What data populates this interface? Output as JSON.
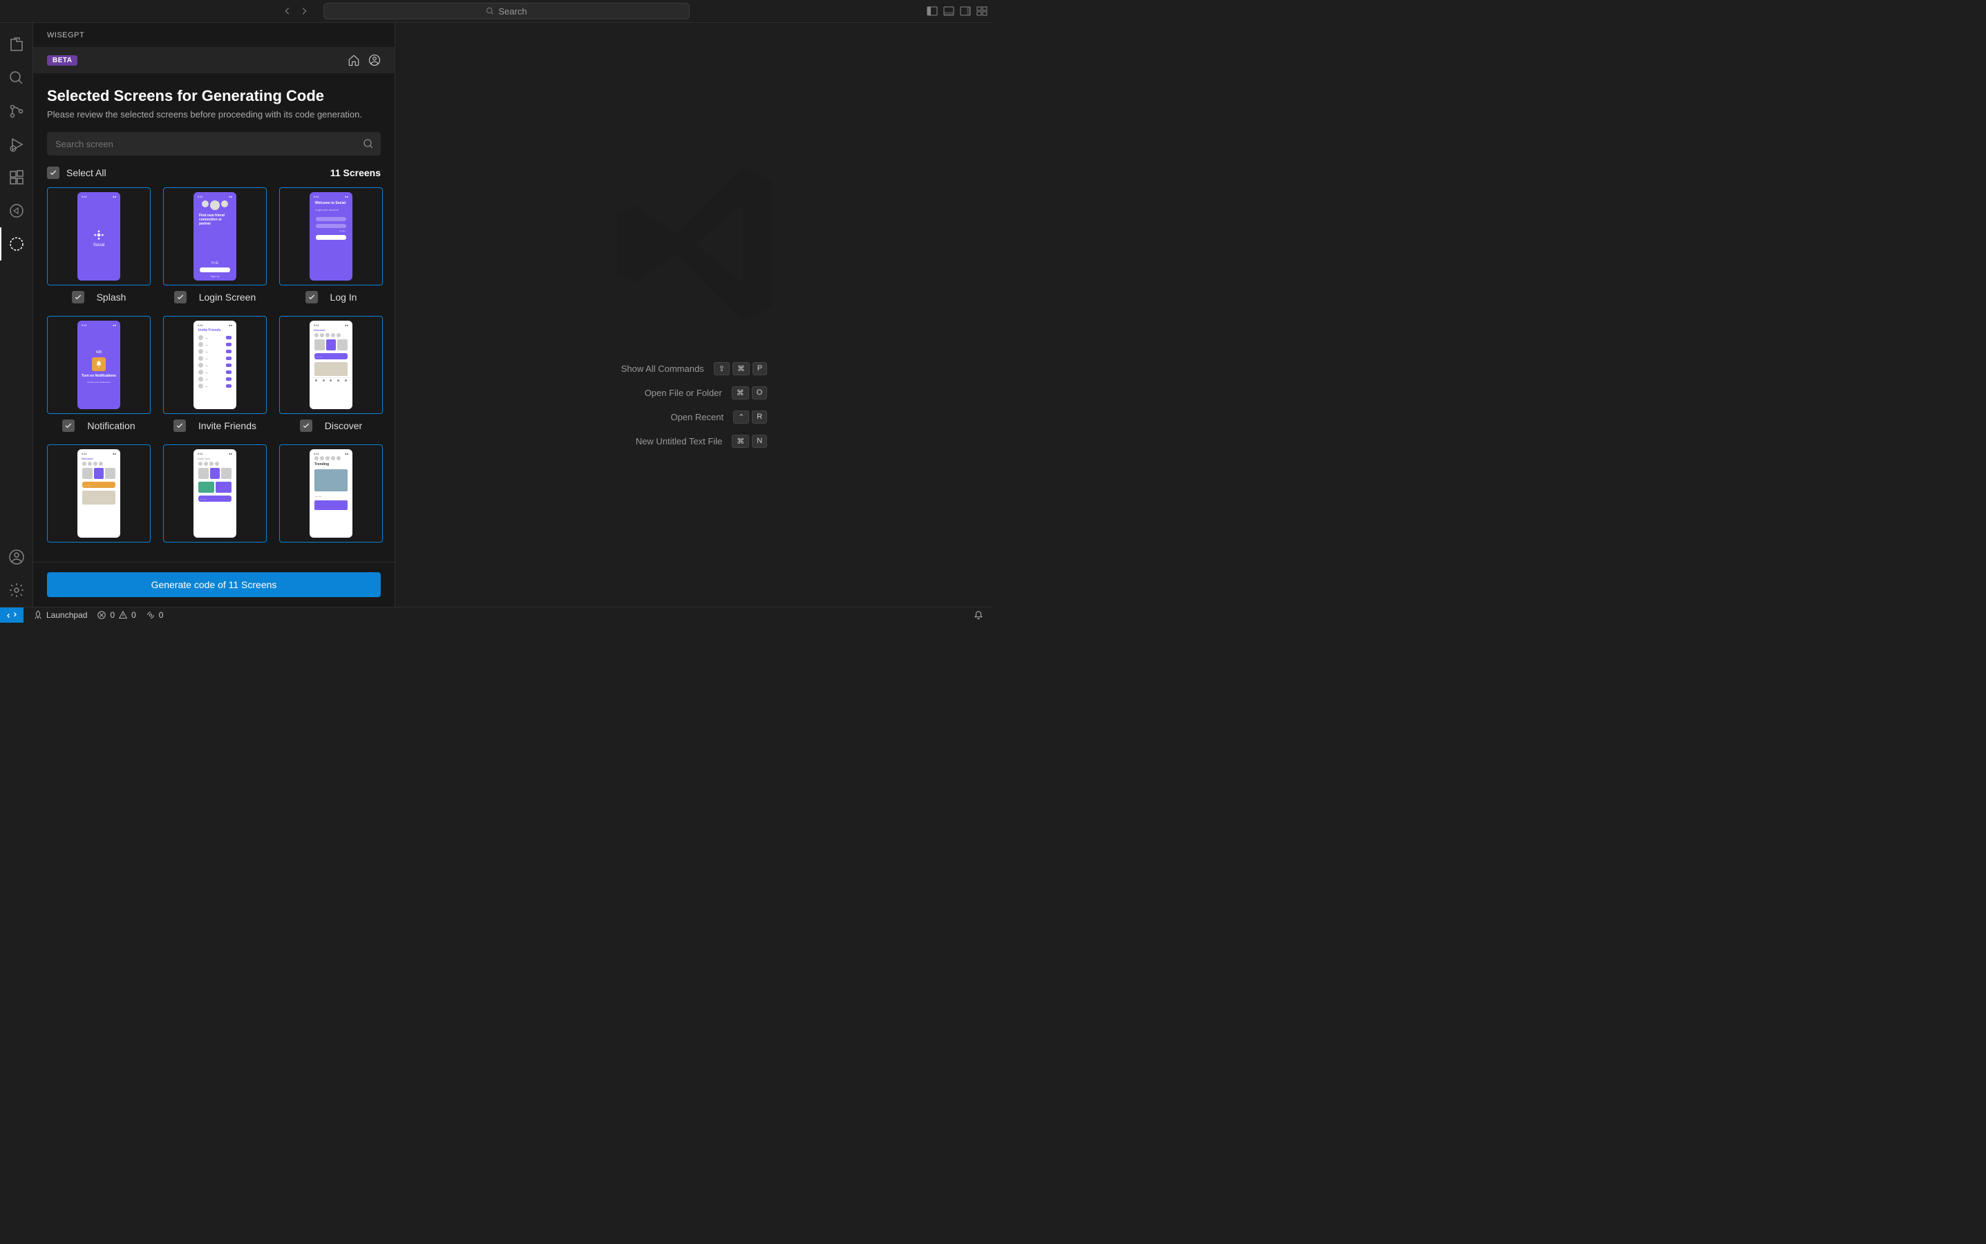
{
  "titlebar": {
    "search_placeholder": "Search"
  },
  "sidebar": {
    "title": "WISEGPT",
    "badge": "BETA"
  },
  "panel": {
    "heading": "Selected Screens for Generating Code",
    "subheading": "Please review the selected screens before proceeding with its code generation.",
    "search_placeholder": "Search screen",
    "select_all": "Select All",
    "screen_count": "11 Screens",
    "screens": [
      {
        "name": "Splash"
      },
      {
        "name": "Login Screen"
      },
      {
        "name": "Log In"
      },
      {
        "name": "Notification"
      },
      {
        "name": "Invite Friends"
      },
      {
        "name": "Discover"
      }
    ],
    "generate": "Generate code of 11 Screens"
  },
  "welcome": {
    "commands": [
      {
        "label": "Show All Commands",
        "keys": [
          "⇧",
          "⌘",
          "P"
        ]
      },
      {
        "label": "Open File or Folder",
        "keys": [
          "⌘",
          "O"
        ]
      },
      {
        "label": "Open Recent",
        "keys": [
          "⌃",
          "R"
        ]
      },
      {
        "label": "New Untitled Text File",
        "keys": [
          "⌘",
          "N"
        ]
      }
    ]
  },
  "statusbar": {
    "launchpad": "Launchpad",
    "errors": "0",
    "warnings": "0",
    "ports": "0"
  }
}
